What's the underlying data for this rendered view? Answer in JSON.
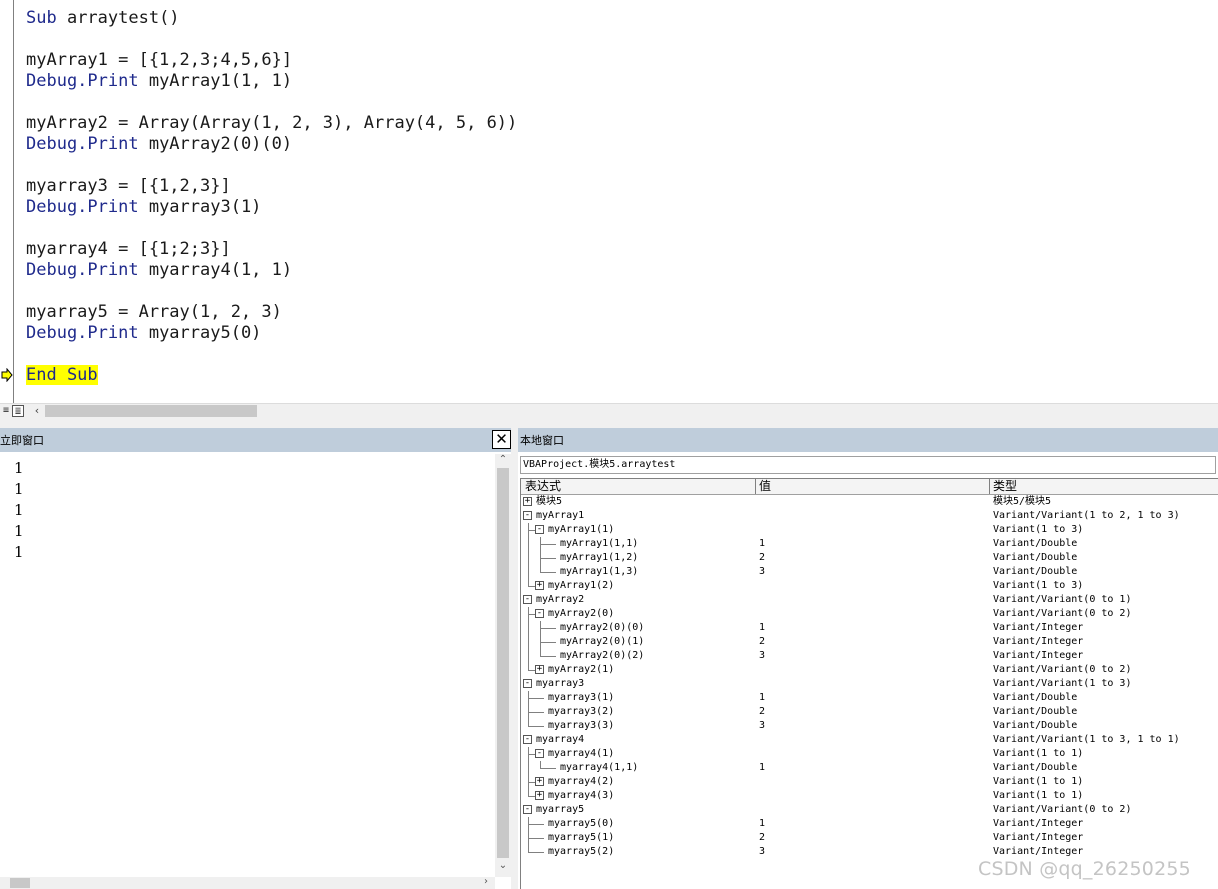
{
  "editor": {
    "lines": [
      {
        "parts": [
          {
            "text": "Sub",
            "kw": true
          },
          {
            "text": " arraytest()",
            "kw": false
          }
        ]
      },
      {
        "parts": []
      },
      {
        "parts": [
          {
            "text": "myArray1 = [{1,2,3;4,5,6}]",
            "kw": false
          }
        ]
      },
      {
        "parts": [
          {
            "text": "Debug.Print",
            "kw": true
          },
          {
            "text": " myArray1(1, 1)",
            "kw": false
          }
        ]
      },
      {
        "parts": []
      },
      {
        "parts": [
          {
            "text": "myArray2 = Array(Array(1, 2, 3), Array(4, 5, 6))",
            "kw": false
          }
        ]
      },
      {
        "parts": [
          {
            "text": "Debug.Print",
            "kw": true
          },
          {
            "text": " myArray2(0)(0)",
            "kw": false
          }
        ]
      },
      {
        "parts": []
      },
      {
        "parts": [
          {
            "text": "myarray3 = [{1,2,3}]",
            "kw": false
          }
        ]
      },
      {
        "parts": [
          {
            "text": "Debug.Print",
            "kw": true
          },
          {
            "text": " myarray3(1)",
            "kw": false
          }
        ]
      },
      {
        "parts": []
      },
      {
        "parts": [
          {
            "text": "myarray4 = [{1;2;3}]",
            "kw": false
          }
        ]
      },
      {
        "parts": [
          {
            "text": "Debug.Print",
            "kw": true
          },
          {
            "text": " myarray4(1, 1)",
            "kw": false
          }
        ]
      },
      {
        "parts": []
      },
      {
        "parts": [
          {
            "text": "myarray5 = Array(1, 2, 3)",
            "kw": false
          }
        ]
      },
      {
        "parts": [
          {
            "text": "Debug.Print",
            "kw": true
          },
          {
            "text": " myarray5(0)",
            "kw": false
          }
        ]
      },
      {
        "parts": []
      },
      {
        "parts": [
          {
            "text": "End Sub",
            "kw": true,
            "highlight": true
          }
        ]
      }
    ],
    "keyword_color": "#1f2a8c",
    "highlight_color": "#ffff00"
  },
  "immediate": {
    "title": "立即窗口",
    "close_label": "✕",
    "output": [
      "1",
      "1",
      "1",
      "1",
      "1"
    ]
  },
  "locals": {
    "title": "本地窗口",
    "context": "VBAProject.模块5.arraytest",
    "columns": {
      "expression": "表达式",
      "value": "值",
      "type": "类型"
    },
    "rows": [
      {
        "level": 0,
        "box": "+",
        "expr": "模块5",
        "value": "",
        "type": "模块5/模块5"
      },
      {
        "level": 0,
        "box": "-",
        "expr": "myArray1",
        "value": "",
        "type": "Variant/Variant(1 to 2, 1 to 3)"
      },
      {
        "level": 1,
        "box": "-",
        "expr": "myArray1(1)",
        "value": "",
        "type": "Variant(1 to 3)"
      },
      {
        "level": 2,
        "box": "",
        "expr": "myArray1(1,1)",
        "value": "1",
        "type": "Variant/Double"
      },
      {
        "level": 2,
        "box": "",
        "expr": "myArray1(1,2)",
        "value": "2",
        "type": "Variant/Double"
      },
      {
        "level": 2,
        "box": "",
        "expr": "myArray1(1,3)",
        "value": "3",
        "type": "Variant/Double"
      },
      {
        "level": 1,
        "box": "+",
        "expr": "myArray1(2)",
        "value": "",
        "type": "Variant(1 to 3)"
      },
      {
        "level": 0,
        "box": "-",
        "expr": "myArray2",
        "value": "",
        "type": "Variant/Variant(0 to 1)"
      },
      {
        "level": 1,
        "box": "-",
        "expr": "myArray2(0)",
        "value": "",
        "type": "Variant/Variant(0 to 2)"
      },
      {
        "level": 2,
        "box": "",
        "expr": "myArray2(0)(0)",
        "value": "1",
        "type": "Variant/Integer"
      },
      {
        "level": 2,
        "box": "",
        "expr": "myArray2(0)(1)",
        "value": "2",
        "type": "Variant/Integer"
      },
      {
        "level": 2,
        "box": "",
        "expr": "myArray2(0)(2)",
        "value": "3",
        "type": "Variant/Integer"
      },
      {
        "level": 1,
        "box": "+",
        "expr": "myArray2(1)",
        "value": "",
        "type": "Variant/Variant(0 to 2)"
      },
      {
        "level": 0,
        "box": "-",
        "expr": "myarray3",
        "value": "",
        "type": "Variant/Variant(1 to 3)"
      },
      {
        "level": 1,
        "box": "",
        "expr": "myarray3(1)",
        "value": "1",
        "type": "Variant/Double"
      },
      {
        "level": 1,
        "box": "",
        "expr": "myarray3(2)",
        "value": "2",
        "type": "Variant/Double"
      },
      {
        "level": 1,
        "box": "",
        "expr": "myarray3(3)",
        "value": "3",
        "type": "Variant/Double"
      },
      {
        "level": 0,
        "box": "-",
        "expr": "myarray4",
        "value": "",
        "type": "Variant/Variant(1 to 3, 1 to 1)"
      },
      {
        "level": 1,
        "box": "-",
        "expr": "myarray4(1)",
        "value": "",
        "type": "Variant(1 to 1)"
      },
      {
        "level": 2,
        "box": "",
        "expr": "myarray4(1,1)",
        "value": "1",
        "type": "Variant/Double"
      },
      {
        "level": 1,
        "box": "+",
        "expr": "myarray4(2)",
        "value": "",
        "type": "Variant(1 to 1)"
      },
      {
        "level": 1,
        "box": "+",
        "expr": "myarray4(3)",
        "value": "",
        "type": "Variant(1 to 1)"
      },
      {
        "level": 0,
        "box": "-",
        "expr": "myarray5",
        "value": "",
        "type": "Variant/Variant(0 to 2)"
      },
      {
        "level": 1,
        "box": "",
        "expr": "myarray5(0)",
        "value": "1",
        "type": "Variant/Integer"
      },
      {
        "level": 1,
        "box": "",
        "expr": "myarray5(1)",
        "value": "2",
        "type": "Variant/Integer"
      },
      {
        "level": 1,
        "box": "",
        "expr": "myarray5(2)",
        "value": "3",
        "type": "Variant/Integer"
      }
    ]
  },
  "watermark": "CSDN @qq_26250255",
  "colors": {
    "title_bar": "#bfcddb",
    "watermark": "#c4c4c4"
  }
}
